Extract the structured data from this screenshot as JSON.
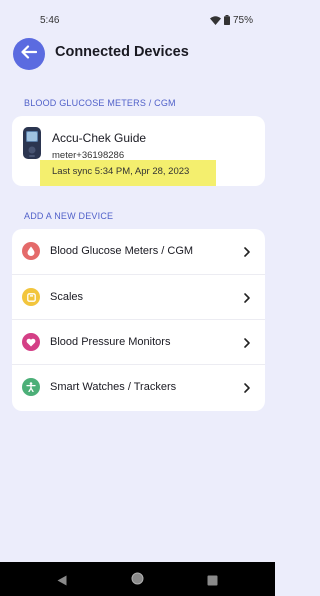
{
  "status_bar": {
    "time": "5:46",
    "battery": "75%",
    "wifi_icon": "wifi-icon",
    "battery_icon": "battery-icon"
  },
  "header": {
    "title": "Connected Devices",
    "back_icon": "arrow-left-icon"
  },
  "connected_section": {
    "label": "BLOOD GLUCOSE METERS / CGM",
    "device": {
      "name": "Accu-Chek Guide",
      "serial": "meter+36198286",
      "last_sync": "Last sync 5:34 PM, Apr 28, 2023",
      "highlight_color": "#f4ef6e"
    }
  },
  "add_section": {
    "label": "ADD A NEW DEVICE",
    "items": [
      {
        "label": "Blood Glucose Meters / CGM",
        "icon": "drop-icon",
        "color": "#e46a6a"
      },
      {
        "label": "Scales",
        "icon": "scale-icon",
        "color": "#f2c53d"
      },
      {
        "label": "Blood Pressure Monitors",
        "icon": "heart-icon",
        "color": "#d43f86"
      },
      {
        "label": "Smart Watches / Trackers",
        "icon": "person-icon",
        "color": "#4caf78"
      }
    ]
  },
  "colors": {
    "background": "#ecedfb",
    "accent": "#5b6be0",
    "section_label": "#5161c9"
  }
}
